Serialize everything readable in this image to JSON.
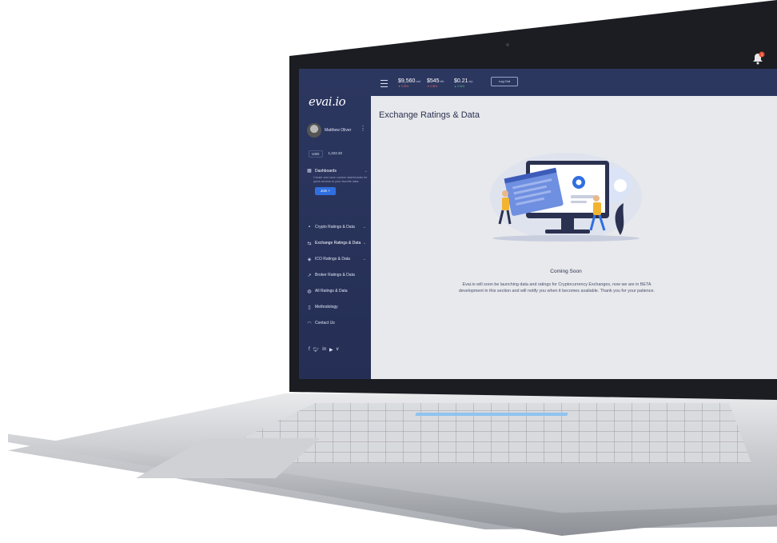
{
  "app": {
    "logo": "evai.io",
    "page_title": "Exchange Ratings & Data"
  },
  "topbar": {
    "tickers": [
      {
        "value": "$9,560",
        "unit": "usd",
        "change": "▼ 0.25%",
        "trend": "down"
      },
      {
        "value": "$545",
        "unit": "eth",
        "change": "▼ 0.35%",
        "trend": "down"
      },
      {
        "value": "$0.21",
        "unit": "xrp",
        "change": "▲ 0.04%",
        "trend": "up"
      }
    ],
    "button_label": "Log Out",
    "notification_count": "1"
  },
  "sidebar": {
    "user_name": "Matthew Oliver",
    "balance_label": "USD",
    "balance_value": "1,222.32",
    "dashboard": {
      "label": "Dashboards",
      "description": "Create and save custom dashboards for quick access to your favorite data.",
      "button_label": "Join +"
    },
    "nav": [
      {
        "label": "Crypto Ratings & Data",
        "icon": "chart-icon",
        "glyph": "▪",
        "has_chevron": true
      },
      {
        "label": "Exchange Ratings & Data",
        "icon": "exchange-icon",
        "glyph": "⇆",
        "has_chevron": true,
        "active": true
      },
      {
        "label": "ICO Ratings & Data",
        "icon": "ico-icon",
        "glyph": "◈",
        "has_chevron": true
      },
      {
        "label": "Broker Ratings & Data",
        "icon": "broker-icon",
        "glyph": "↗",
        "has_chevron": false
      },
      {
        "label": "All Ratings & Data",
        "icon": "globe-icon",
        "glyph": "◍",
        "has_chevron": false
      },
      {
        "label": "Methodology",
        "icon": "book-icon",
        "glyph": "▯",
        "has_chevron": false
      },
      {
        "label": "Contact Us",
        "icon": "headset-icon",
        "glyph": "◠",
        "has_chevron": false
      }
    ],
    "social": [
      "f",
      "t",
      "in",
      "yt",
      "v"
    ]
  },
  "main": {
    "coming_title": "Coming Soon",
    "coming_text": "Evai.io will soon be launching data and ratings for Cryptocurrency Exchanges, now we are in BETA development in this section and will notify you when it becomes available. Thank you for your patience."
  },
  "colors": {
    "sidebar": "#2c3760",
    "accent": "#2f6fe0",
    "screen_bg": "#e8e9ec",
    "alert": "#e8492f"
  }
}
